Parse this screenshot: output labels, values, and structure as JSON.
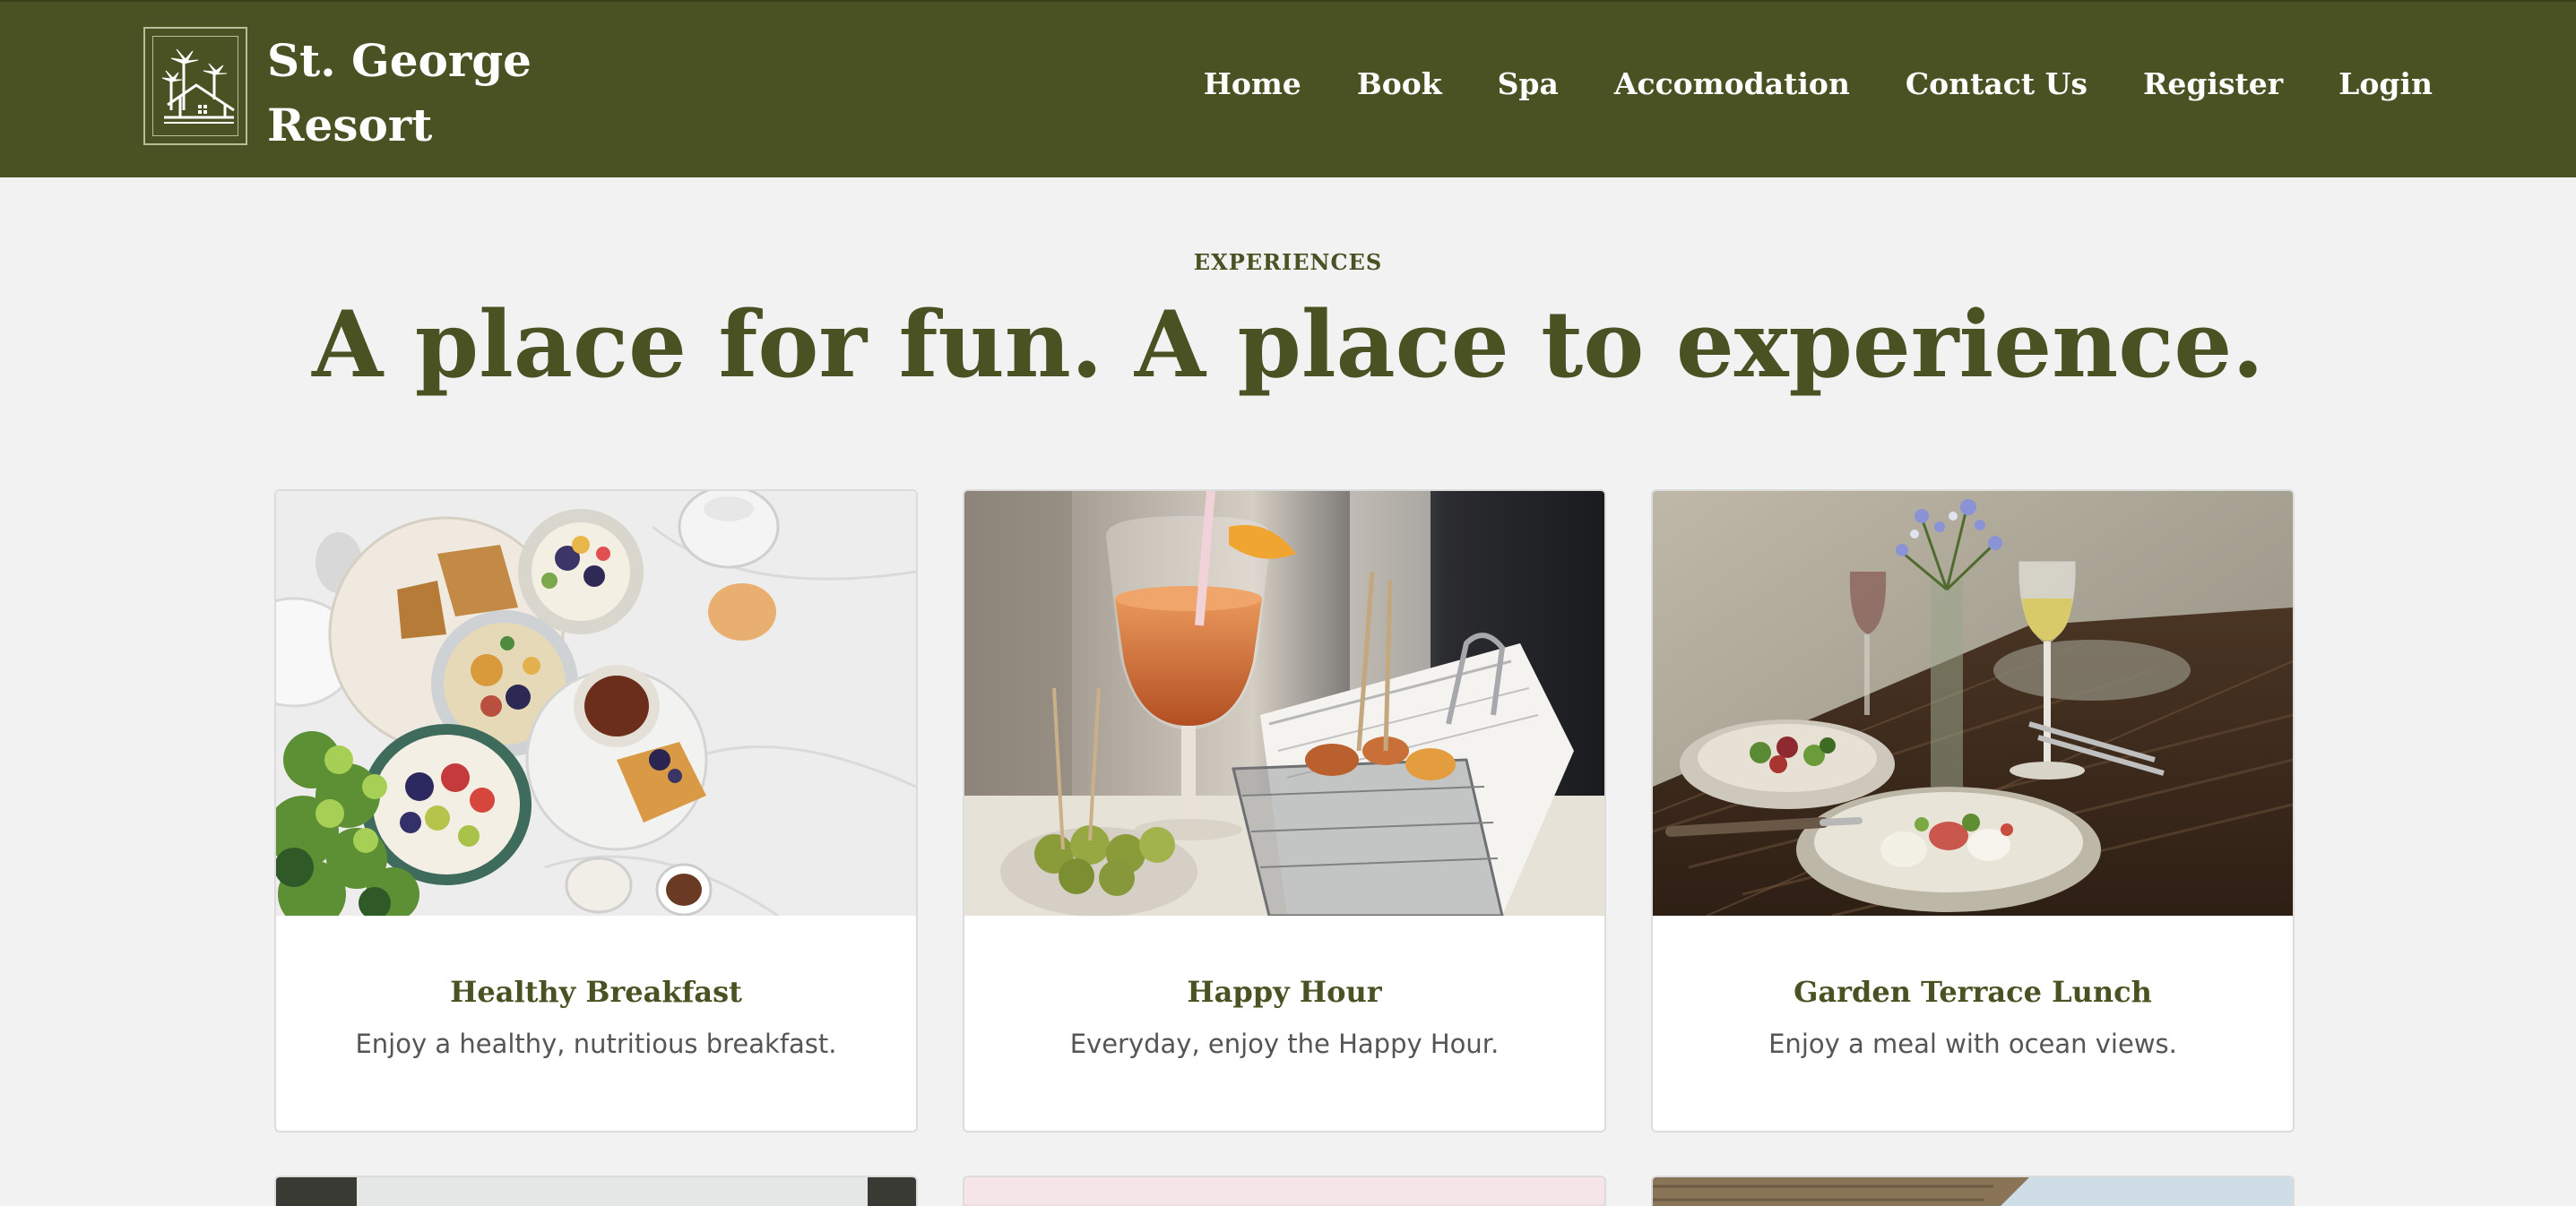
{
  "brand": {
    "line1": "St. George",
    "line2": "Resort"
  },
  "nav": [
    "Home",
    "Book",
    "Spa",
    "Accomodation",
    "Contact Us",
    "Register",
    "Login"
  ],
  "section": {
    "eyebrow": "EXPERIENCES",
    "headline": "A place for fun. A place to experience."
  },
  "cards": [
    {
      "title": "Healthy Breakfast",
      "description": "Enjoy a healthy, nutritious breakfast."
    },
    {
      "title": "Happy Hour",
      "description": "Everyday, enjoy the Happy Hour."
    },
    {
      "title": "Garden Terrace Lunch",
      "description": "Enjoy a meal with ocean views."
    }
  ],
  "colors": {
    "brand_green": "#4a5122",
    "page_bg": "#f2f2f2",
    "card_bg": "#ffffff"
  }
}
